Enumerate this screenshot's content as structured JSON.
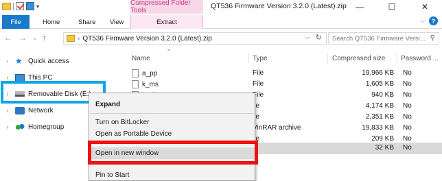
{
  "title_bar": {
    "contextual_tab_group": "Compressed Folder Tools",
    "window_title": "QT536  Firmware Version 3.2.0 (Latest).zip",
    "minimize_glyph": "—",
    "maximize_glyph": "☐",
    "close_glyph": "✕"
  },
  "ribbon": {
    "tabs": [
      "File",
      "Home",
      "Share",
      "View",
      "Extract"
    ],
    "expand_glyph": "⌵",
    "help_glyph": "?"
  },
  "address_bar": {
    "back_glyph": "←",
    "forward_glyph": "→",
    "recent_glyph": "⌄",
    "up_glyph": "↑",
    "separator_glyph": "›",
    "path": "QT536  Firmware Version 3.2.0 (Latest).zip",
    "dropdown_glyph": "⌵",
    "refresh_glyph": "↻"
  },
  "search": {
    "placeholder": "Search QT536  Firmware Versi...",
    "icon": "magnifier-icon"
  },
  "nav_pane": {
    "expand_glyph": "›",
    "items": [
      {
        "label": "Quick access",
        "icon": "star-icon"
      },
      {
        "label": "This PC",
        "icon": "computer-icon"
      },
      {
        "label": "Removable Disk (E:)",
        "icon": "removable-disk-icon"
      },
      {
        "label": "Network",
        "icon": "network-icon"
      },
      {
        "label": "Homegroup",
        "icon": "homegroup-icon"
      }
    ]
  },
  "columns": {
    "name": "Name",
    "type": "Type",
    "compressed_size": "Compressed size",
    "password": "Password ...",
    "sort_glyph": "^"
  },
  "files": [
    {
      "name": "a_pp",
      "type": "File",
      "size": "19,966 KB",
      "password": "No"
    },
    {
      "name": "k_ms",
      "type": "File",
      "size": "1,605 KB",
      "password": "No"
    },
    {
      "name": "k_sl",
      "type": "File",
      "size": "940 KB",
      "password": "No"
    },
    {
      "name": "",
      "type": "ile",
      "size": "4,174 KB",
      "password": "No"
    },
    {
      "name": "",
      "type": "ile",
      "size": "2,351 KB",
      "password": "No"
    },
    {
      "name": "",
      "type": "VinRAR archive",
      "size": "19,833 KB",
      "password": "No"
    },
    {
      "name": "",
      "type": "ile",
      "size": "209 KB",
      "password": "No"
    },
    {
      "name": "",
      "type": "",
      "size": "32 KB",
      "password": "No"
    }
  ],
  "context_menu": {
    "items": [
      "Expand",
      "Turn on BitLocker",
      "Open as Portable Device",
      "Open in new window",
      "Pin to Start"
    ]
  },
  "colors": {
    "file_tab": "#1979ca",
    "contextual_tab_bg": "#f8d7e8",
    "contextual_tab_text": "#c23a7a",
    "blue_highlight": "#0aa6e8",
    "red_highlight": "#ee1111",
    "selected_row": "#d9d9d9"
  }
}
